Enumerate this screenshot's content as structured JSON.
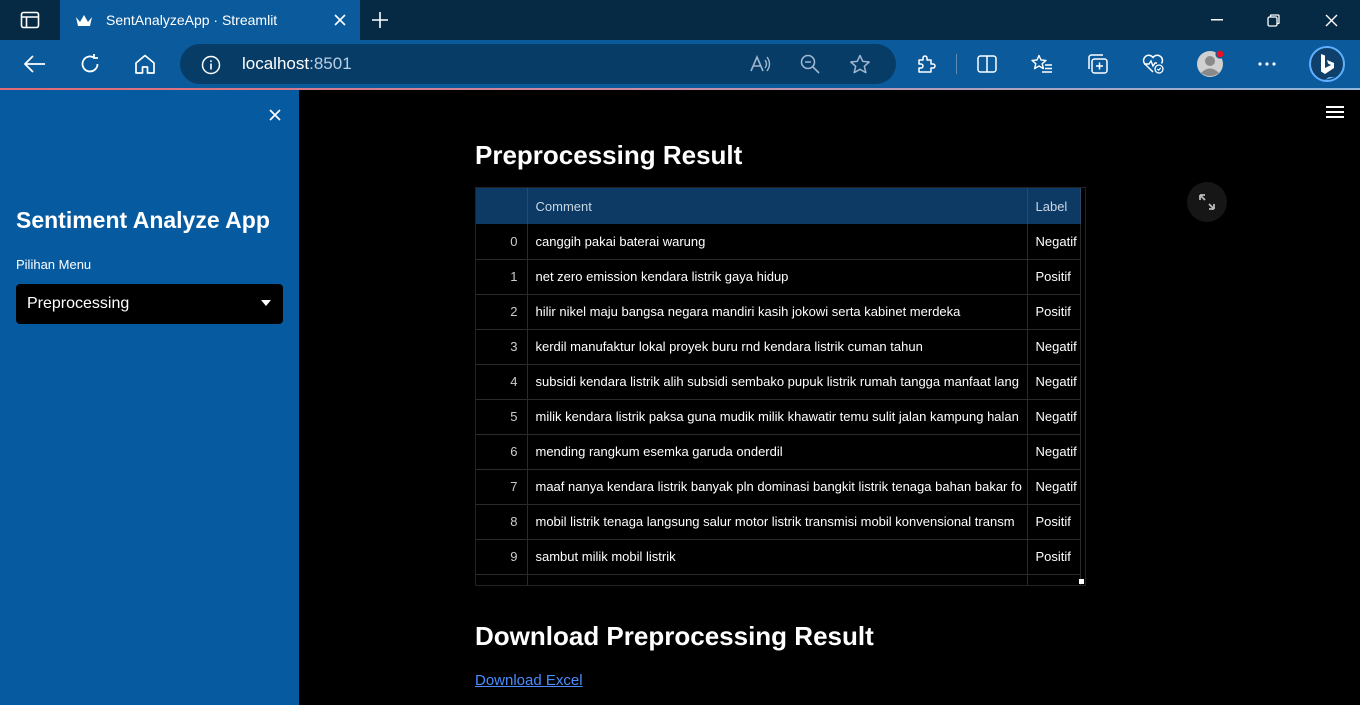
{
  "browser": {
    "tab_title": "SentAnalyzeApp · Streamlit",
    "url_host": "localhost",
    "url_port": ":8501",
    "icons": [
      "tab-actions-icon",
      "streamlit-favicon",
      "close-tab-icon",
      "new-tab-icon",
      "minimize-icon",
      "restore-icon",
      "close-window-icon",
      "back-icon",
      "refresh-icon",
      "home-icon",
      "site-info-icon",
      "read-aloud-icon",
      "zoom-out-icon",
      "favorite-star-icon",
      "extensions-icon",
      "split-screen-icon",
      "favorites-icon",
      "collections-icon",
      "browser-essentials-icon",
      "profile-avatar",
      "more-menu-icon",
      "bing-copilot-icon"
    ]
  },
  "sidebar": {
    "title": "Sentiment Analyze App",
    "menu_label": "Pilihan Menu",
    "menu_value": "Preprocessing"
  },
  "main": {
    "heading": "Preprocessing Result",
    "download_heading": "Download Preprocessing Result",
    "download_link": "Download Excel",
    "table": {
      "columns": [
        "",
        "Comment",
        "Label"
      ],
      "rows": [
        {
          "index": "0",
          "comment": "canggih pakai baterai warung",
          "label": "Negatif"
        },
        {
          "index": "1",
          "comment": "net zero emission kendara listrik gaya hidup",
          "label": "Positif"
        },
        {
          "index": "2",
          "comment": "hilir nikel maju bangsa negara mandiri kasih jokowi serta kabinet merdeka",
          "label": "Positif"
        },
        {
          "index": "3",
          "comment": "kerdil manufaktur lokal proyek buru rnd kendara listrik cuman tahun",
          "label": "Negatif"
        },
        {
          "index": "4",
          "comment": "subsidi kendara listrik alih subsidi sembako pupuk listrik rumah tangga manfaat lang",
          "label": "Negatif"
        },
        {
          "index": "5",
          "comment": "milik kendara listrik paksa guna mudik milik khawatir temu sulit jalan kampung halan",
          "label": "Negatif"
        },
        {
          "index": "6",
          "comment": "mending rangkum esemka garuda onderdil",
          "label": "Negatif"
        },
        {
          "index": "7",
          "comment": "maaf nanya kendara listrik banyak pln dominasi bangkit listrik tenaga bahan bakar fo",
          "label": "Negatif"
        },
        {
          "index": "8",
          "comment": "mobil listrik tenaga langsung salur motor listrik transmisi mobil konvensional transm",
          "label": "Positif"
        },
        {
          "index": "9",
          "comment": "sambut milik mobil listrik",
          "label": "Positif"
        }
      ]
    }
  },
  "colors": {
    "sidebar_bg": "#065aa0",
    "main_bg": "#000000",
    "table_header_bg": "#0d3a64",
    "link": "#4a8cff"
  }
}
